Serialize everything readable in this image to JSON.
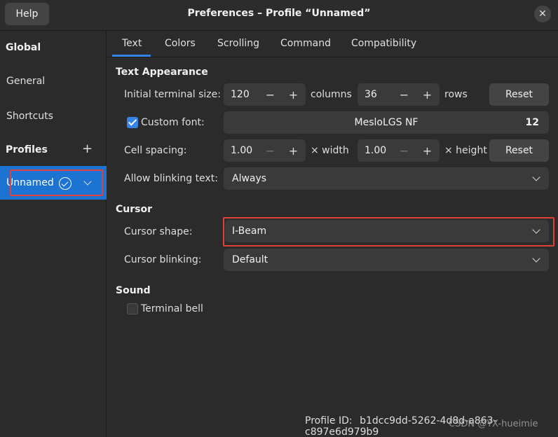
{
  "window": {
    "title": "Preferences – Profile “Unnamed”",
    "help_label": "Help",
    "close_glyph": "✕"
  },
  "sidebar": {
    "global_heading": "Global",
    "items": [
      {
        "label": "General"
      },
      {
        "label": "Shortcuts"
      }
    ],
    "profiles_heading": "Profiles",
    "add_glyph": "+",
    "profile": {
      "name": "Unnamed",
      "default_icon": "check-circle-icon",
      "menu_icon": "chevron-down-icon"
    }
  },
  "tabs": [
    {
      "label": "Text",
      "active": true
    },
    {
      "label": "Colors"
    },
    {
      "label": "Scrolling"
    },
    {
      "label": "Command"
    },
    {
      "label": "Compatibility"
    }
  ],
  "text_appearance": {
    "heading": "Text Appearance",
    "terminal_size_label": "Initial terminal size:",
    "columns_value": "120",
    "columns_unit": "columns",
    "rows_value": "36",
    "rows_unit": "rows",
    "reset_label": "Reset",
    "custom_font_label": "Custom font:",
    "custom_font_checked": true,
    "font_name": "MesloLGS NF",
    "font_size": "12",
    "cell_spacing_label": "Cell spacing:",
    "width_value": "1.00",
    "width_unit": "× width",
    "height_value": "1.00",
    "height_unit": "× height",
    "blinking_text_label": "Allow blinking text:",
    "blinking_text_value": "Always"
  },
  "cursor": {
    "heading": "Cursor",
    "shape_label": "Cursor shape:",
    "shape_value": "I-Beam",
    "blinking_label": "Cursor blinking:",
    "blinking_value": "Default"
  },
  "sound": {
    "heading": "Sound",
    "terminal_bell_label": "Terminal bell",
    "terminal_bell_checked": false
  },
  "footer": {
    "profile_id_label": "Profile ID:",
    "profile_id_value": "b1dcc9dd-5262-4d8d-a863-c897e6d979b9",
    "watermark": "CSDN @YX-hueimie"
  },
  "glyphs": {
    "minus": "−",
    "plus": "+"
  },
  "colors": {
    "accent": "#3584e4",
    "selected_row": "#1c73d1",
    "highlight_border": "#e0403a",
    "background": "#2b2b2b"
  }
}
